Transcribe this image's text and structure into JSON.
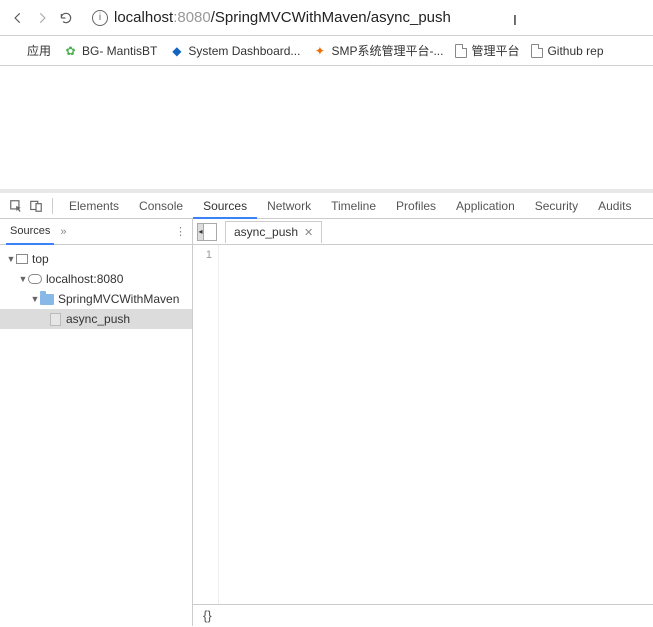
{
  "address": {
    "host": "localhost",
    "port": ":8080",
    "path": "/SpringMVCWithMaven/async_push"
  },
  "bookmarks": {
    "apps": "应用",
    "items": [
      {
        "label": "BG- MantisBT"
      },
      {
        "label": "System Dashboard..."
      },
      {
        "label": "SMP系统管理平台-..."
      },
      {
        "label": "管理平台"
      },
      {
        "label": "Github rep"
      }
    ]
  },
  "devtools": {
    "tabs": [
      "Elements",
      "Console",
      "Sources",
      "Network",
      "Timeline",
      "Profiles",
      "Application",
      "Security",
      "Audits"
    ],
    "activeTab": "Sources",
    "sidebar": {
      "label": "Sources",
      "tree": {
        "top": "top",
        "host": "localhost:8080",
        "folder": "SpringMVCWithMaven",
        "file": "async_push"
      }
    },
    "openFile": "async_push",
    "gutter": "1",
    "status": "{}"
  }
}
